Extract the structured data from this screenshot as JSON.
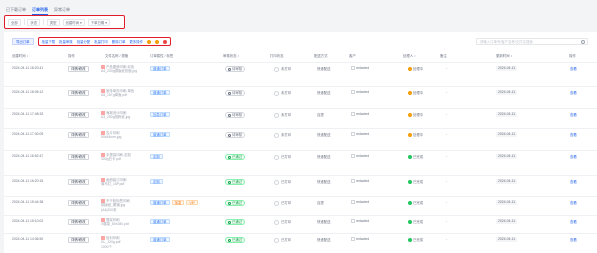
{
  "tabs": [
    {
      "label": "已下载订单",
      "active": false
    },
    {
      "label": "订单列表",
      "active": true
    },
    {
      "label": "异常订单",
      "active": false
    }
  ],
  "filters": [
    "全部",
    "状态",
    "类型",
    "创建时间 ▾",
    "下单日期 ▾"
  ],
  "actions": {
    "primary": "导出订单",
    "bulk": [
      "批量下载",
      "批量审核",
      "批量分配",
      "批量打印",
      "删除订单",
      "更多操作"
    ]
  },
  "search": {
    "placeholder": "请输入订单号/客户名称/文件名搜索"
  },
  "columns": [
    "创建时间 ↕",
    "操作",
    "文件名称 / 规格",
    "订单属性 / 标签",
    "审核状态 ↕",
    "打印状态",
    "配送方式",
    "客户",
    "处理人 ↕",
    "备注",
    "更新时间 ↕",
    "操作"
  ],
  "rows": [
    {
      "time": "2024-04-11 18:20:41",
      "edit": "详情/修改",
      "file": [
        "产品图册印刷-彩色",
        "A4_200g铜版纸双面.jpg"
      ],
      "tags": [
        "普通订单"
      ],
      "status": "待审核",
      "ok": false,
      "print": "未打印",
      "ship": "快递配送",
      "customer": "redacted",
      "handler": "处理中",
      "note": "-",
      "updated": "2024-04-11",
      "op": "查看"
    },
    {
      "time": "2024-04-11 18:05:12",
      "edit": "详情/修改",
      "file": [
        "宣传单页印刷-单色",
        "A5_157g单面.pdf"
      ],
      "tags": [
        "普通订单"
      ],
      "status": "待审核",
      "ok": false,
      "print": "未打印",
      "ship": "快递配送",
      "customer": "redacted",
      "handler": "处理中",
      "note": "-",
      "updated": "2024-04-11",
      "op": "查看"
    },
    {
      "time": "2024-04-11 17:48:33",
      "edit": "详情/修改",
      "file": [
        "海报设计印刷",
        "A3_250g哑粉纸.jpg"
      ],
      "tags": [
        "加急订单"
      ],
      "status": "待审核",
      "ok": false,
      "print": "未打印",
      "ship": "自提",
      "customer": "redacted",
      "handler": "处理中",
      "note": "-",
      "updated": "2024-04-11",
      "op": "查看"
    },
    {
      "time": "2024-04-11 17:30:09",
      "edit": "详情/修改",
      "file": [
        "名片印刷",
        "90x54mm.jpg"
      ],
      "tags": [
        "普通订单"
      ],
      "status": "待审核",
      "ok": false,
      "print": "未打印",
      "ship": "快递配送",
      "customer": "redacted",
      "handler": "处理中",
      "note": "-",
      "updated": "2024-04-11",
      "op": "查看"
    },
    {
      "time": "2024-04-11 16:52:47",
      "edit": "详情/修改",
      "file": [
        "手提袋印刷-定制",
        "300g白卡.pdf"
      ],
      "tags": [
        "定制"
      ],
      "status": "已通过",
      "ok": true,
      "print": "已打印",
      "ship": "快递配送",
      "customer": "redacted",
      "handler": "已完成",
      "note": "-",
      "updated": "2024-04-11",
      "op": "查看"
    },
    {
      "time": "2024-04-11 16:20:15",
      "edit": "详情/修改",
      "file": [
        "画册装订印刷",
        "骑马钉_16P.pdf"
      ],
      "tags": [
        "定制"
      ],
      "status": "已通过",
      "ok": true,
      "print": "已打印",
      "ship": "快递配送",
      "customer": "redacted",
      "handler": "已完成",
      "note": "-",
      "updated": "2024-04-11",
      "op": "查看"
    },
    {
      "time": "2024-04-11 15:44:38",
      "edit": "详情/修改",
      "file": [
        "不干胶标签印刷",
        "铜版纸_覆膜.jpg",
        "(A4)200张"
      ],
      "tags": [
        "普通订单",
        "加急",
        "VIP"
      ],
      "status": "已通过",
      "ok": true,
      "print": "已打印",
      "ship": "自提",
      "customer": "redacted",
      "handler": "已完成",
      "note": "-",
      "updated": "2024-04-11",
      "op": "查看"
    },
    {
      "time": "2024-04-11 15:10:02",
      "edit": "详情/修改",
      "file": [
        "展架印刷",
        "X展架_80x180.pdf"
      ],
      "tags": [
        "普通订单"
      ],
      "status": "已通过",
      "ok": true,
      "print": "已打印",
      "ship": "快递配送",
      "customer": "redacted",
      "handler": "已完成",
      "note": "-",
      "updated": "2024-04-11",
      "op": "查看"
    },
    {
      "time": "2024-04-11 14:36:50",
      "edit": "详情/修改",
      "file": [
        "信封印刷",
        "DL_120g.pdf",
        "1000个"
      ],
      "tags": [
        "普通订单"
      ],
      "status": "已通过",
      "ok": true,
      "print": "已打印",
      "ship": "快递配送",
      "customer": "redacted",
      "handler": "已完成",
      "note": "-",
      "updated": "2024-04-11",
      "op": "查看"
    }
  ]
}
